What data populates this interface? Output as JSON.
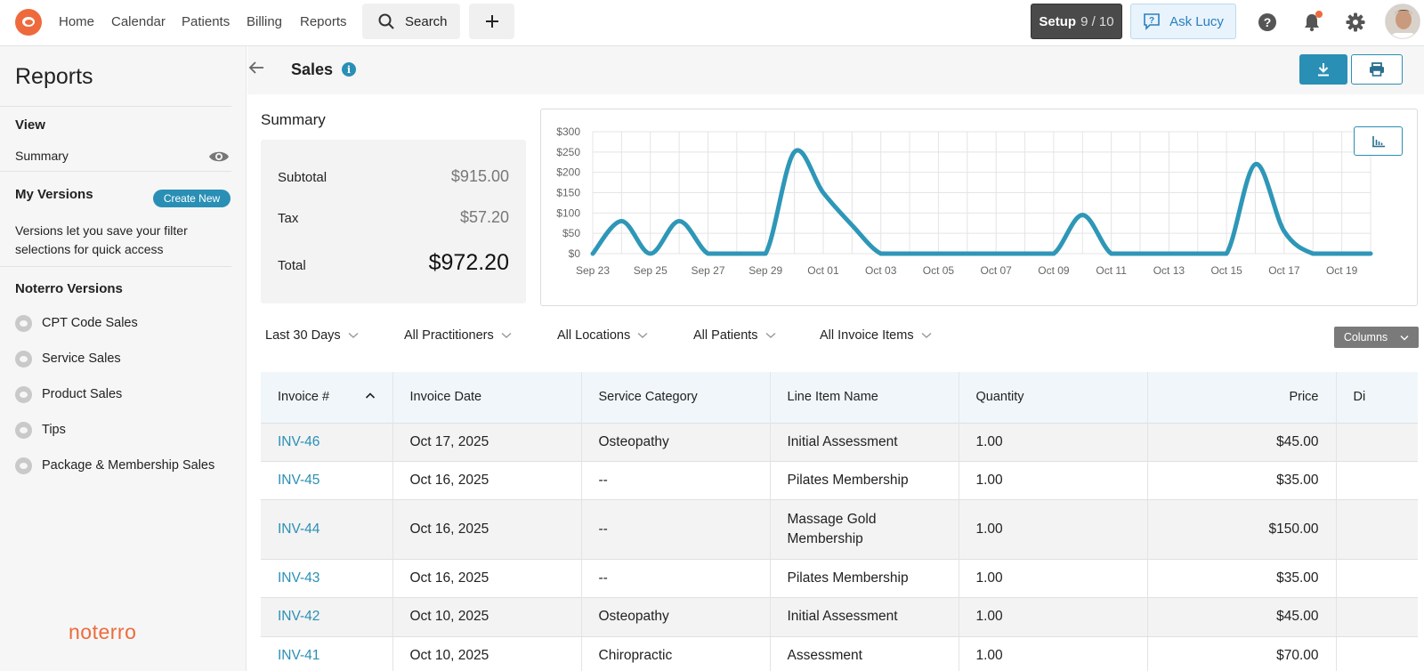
{
  "nav": {
    "links": [
      "Home",
      "Calendar",
      "Patients",
      "Billing",
      "Reports"
    ],
    "search_label": "Search",
    "setup_label": "Setup",
    "setup_progress": "9 / 10",
    "ask_label": "Ask Lucy"
  },
  "sidebar": {
    "title": "Reports",
    "view_heading": "View",
    "summary_label": "Summary",
    "my_versions_heading": "My Versions",
    "create_new_label": "Create New",
    "versions_description": "Versions let you save your filter selections for quick access",
    "noterro_versions_heading": "Noterro Versions",
    "versions": [
      "CPT Code Sales",
      "Service Sales",
      "Product Sales",
      "Tips",
      "Package & Membership Sales"
    ],
    "brand": "noterro"
  },
  "page": {
    "title": "Sales"
  },
  "summary": {
    "label": "Summary",
    "subtotal_label": "Subtotal",
    "subtotal_value": "$915.00",
    "tax_label": "Tax",
    "tax_value": "$57.20",
    "total_label": "Total",
    "total_value": "$972.20"
  },
  "chart_data": {
    "type": "line",
    "title": "",
    "xlabel": "",
    "ylabel": "",
    "ylim": [
      0,
      300
    ],
    "y_ticks": [
      "$0",
      "$50",
      "$100",
      "$150",
      "$200",
      "$250",
      "$300"
    ],
    "x_tick_labels": [
      "Sep 23",
      "Sep 25",
      "Sep 27",
      "Sep 29",
      "Oct 01",
      "Oct 03",
      "Oct 05",
      "Oct 07",
      "Oct 09",
      "Oct 11",
      "Oct 13",
      "Oct 15",
      "Oct 17",
      "Oct 19"
    ],
    "x": [
      "Sep 23",
      "Sep 24",
      "Sep 25",
      "Sep 26",
      "Sep 27",
      "Sep 28",
      "Sep 29",
      "Sep 30",
      "Oct 01",
      "Oct 02",
      "Oct 03",
      "Oct 04",
      "Oct 05",
      "Oct 06",
      "Oct 07",
      "Oct 08",
      "Oct 09",
      "Oct 10",
      "Oct 11",
      "Oct 12",
      "Oct 13",
      "Oct 14",
      "Oct 15",
      "Oct 16",
      "Oct 17",
      "Oct 18",
      "Oct 19",
      "Oct 20"
    ],
    "series": [
      {
        "values": [
          0,
          80,
          0,
          80,
          0,
          0,
          0,
          250,
          150,
          70,
          0,
          0,
          0,
          0,
          0,
          0,
          0,
          95,
          0,
          0,
          0,
          0,
          0,
          220,
          55,
          0,
          0,
          0
        ]
      }
    ],
    "grid": true,
    "line_color": "#2e97b8"
  },
  "filters": {
    "date_range": "Last 30 Days",
    "practitioners": "All Practitioners",
    "locations": "All Locations",
    "patients": "All Patients",
    "invoice_items": "All Invoice Items",
    "columns_label": "Columns"
  },
  "table": {
    "headers": [
      "Invoice #",
      "Invoice Date",
      "Service Category",
      "Line Item Name",
      "Quantity",
      "Price",
      "Di"
    ],
    "rows": [
      [
        "INV-46",
        "Oct 17, 2025",
        "Osteopathy",
        "Initial Assessment",
        "1.00",
        "$45.00",
        ""
      ],
      [
        "INV-45",
        "Oct 16, 2025",
        "--",
        "Pilates Membership",
        "1.00",
        "$35.00",
        ""
      ],
      [
        "INV-44",
        "Oct 16, 2025",
        "--",
        "Massage Gold Membership",
        "1.00",
        "$150.00",
        ""
      ],
      [
        "INV-43",
        "Oct 16, 2025",
        "--",
        "Pilates Membership",
        "1.00",
        "$35.00",
        ""
      ],
      [
        "INV-42",
        "Oct 10, 2025",
        "Osteopathy",
        "Initial Assessment",
        "1.00",
        "$45.00",
        ""
      ],
      [
        "INV-41",
        "Oct 10, 2025",
        "Chiropractic",
        "Assessment",
        "1.00",
        "$70.00",
        ""
      ]
    ]
  },
  "colors": {
    "accent": "#2a8fb5",
    "brand": "#ee6a3c"
  }
}
